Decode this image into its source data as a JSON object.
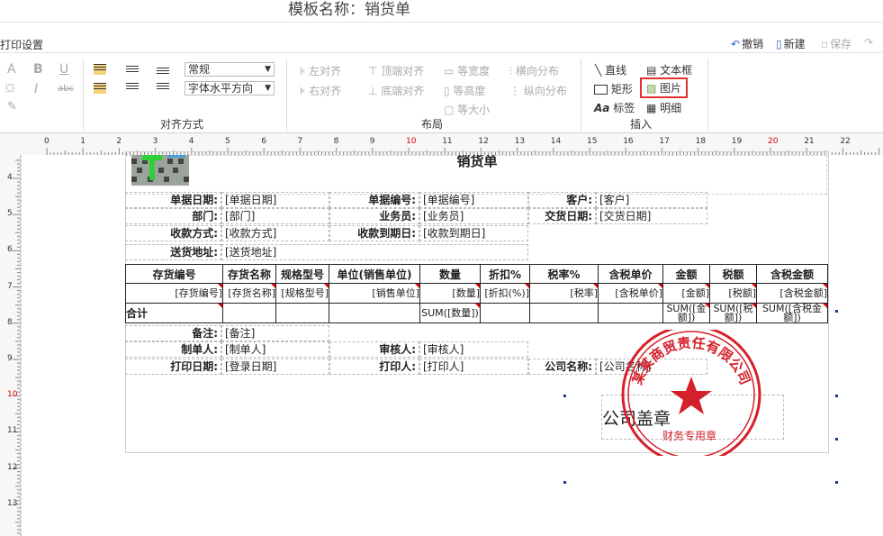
{
  "window_title": "模板名称：销货单",
  "toolbar": {
    "print_settings": "打印设置",
    "undo": "撤销",
    "new": "新建",
    "save": "保存"
  },
  "ribbon": {
    "font": {
      "normal": "常规",
      "horizontal_dir": "字体水平方向"
    },
    "align_group": "对齐方式",
    "layout": {
      "left": "左对齐",
      "right": "右对齐",
      "top": "顶端对齐",
      "bottom": "底端对齐",
      "same_width": "等宽度",
      "same_height": "等高度",
      "same_size": "等大小",
      "h_dist": "横向分布",
      "v_dist": "纵向分布",
      "group": "布局"
    },
    "insert": {
      "line": "直线",
      "rect": "矩形",
      "label": "标签",
      "textbox": "文本框",
      "image": "图片",
      "detail": "明细",
      "group": "插入"
    }
  },
  "ruler": {
    "h": [
      "0",
      "1",
      "2",
      "3",
      "4",
      "5",
      "6",
      "7",
      "8",
      "9",
      "10",
      "11",
      "12",
      "13",
      "14",
      "15",
      "16",
      "17",
      "18",
      "19",
      "20",
      "21",
      "22"
    ],
    "v": [
      "4",
      "5",
      "6",
      "7",
      "8",
      "9",
      "10",
      "11",
      "12",
      "13"
    ]
  },
  "doc": {
    "heading": "销货单",
    "fields": {
      "bill_date_l": "单据日期:",
      "bill_date_v": "[单据日期]",
      "bill_no_l": "单据编号:",
      "bill_no_v": "[单据编号]",
      "customer_l": "客户:",
      "customer_v": "[客户]",
      "dept_l": "部门:",
      "dept_v": "[部门]",
      "clerk_l": "业务员:",
      "clerk_v": "[业务员]",
      "deliv_date_l": "交货日期:",
      "deliv_date_v": "[交货日期]",
      "pay_method_l": "收款方式:",
      "pay_method_v": "[收款方式]",
      "pay_due_l": "收款到期日:",
      "pay_due_v": "[收款到期日]",
      "ship_addr_l": "送货地址:",
      "ship_addr_v": "[送货地址]"
    },
    "table": {
      "headers": [
        "存货编号",
        "存货名称",
        "规格型号",
        "单位(销售单位)",
        "数量",
        "折扣%",
        "税率%",
        "含税单价",
        "金额",
        "税额",
        "含税金额"
      ],
      "row": [
        "[存货编号]",
        "[存货名称]",
        "[规格型号]",
        "[销售单位]",
        "[数量]",
        "[折扣(%)]",
        "[税率]",
        "[含税单价]",
        "[金额]",
        "[税额]",
        "[含税金额]"
      ],
      "total": [
        "合计",
        "",
        "",
        "",
        "SUM([数量])",
        "",
        "",
        "",
        "SUM([金额])",
        "SUM([税额])",
        "SUM([含税金额])"
      ]
    },
    "footer": {
      "remark_l": "备注:",
      "remark_v": "[备注]",
      "maker_l": "制单人:",
      "maker_v": "[制单人]",
      "auditor_l": "审核人:",
      "auditor_v": "[审核人]",
      "print_date_l": "打印日期:",
      "print_date_v": "[登录日期]",
      "printer_l": "打印人:",
      "printer_v": "[打印人]",
      "company_l": "公司名称:",
      "company_v": "[公司名称]"
    },
    "seal_box_label": "公司盖章",
    "stamp": {
      "outer_text": "某某商贸责任有限公司",
      "inner_text": "财务专用章"
    }
  }
}
